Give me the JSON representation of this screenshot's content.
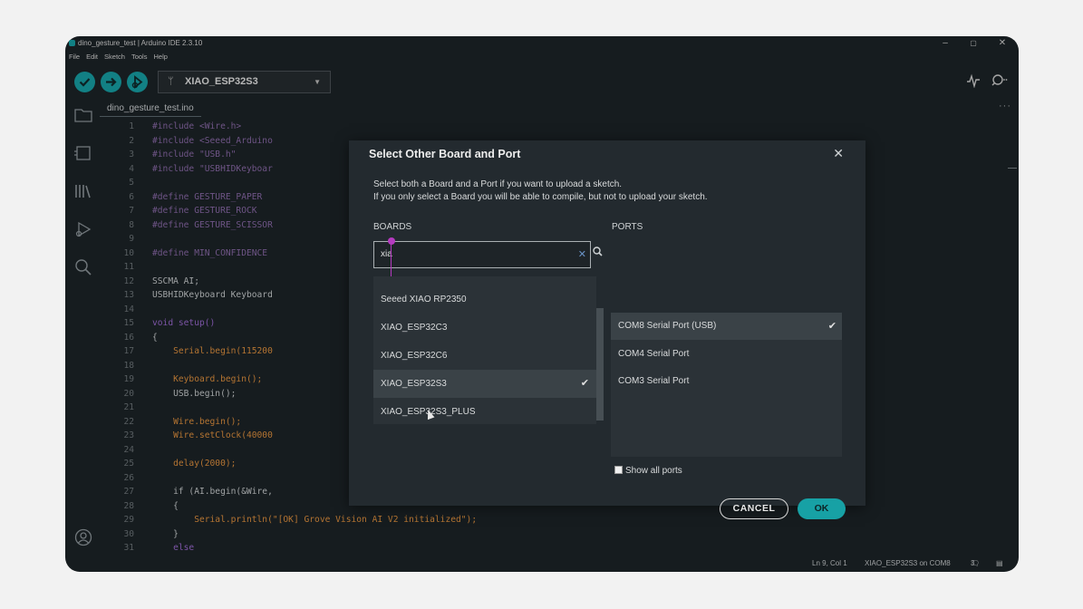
{
  "window": {
    "title": "dino_gesture_test | Arduino IDE 2.3.10",
    "controls": {
      "minimize": "–",
      "maximize": "▢",
      "close": "✕"
    }
  },
  "menu": [
    "File",
    "Edit",
    "Sketch",
    "Tools",
    "Help"
  ],
  "toolbar": {
    "verify_icon": "check-icon",
    "upload_icon": "arrow-right-icon",
    "debug_icon": "debug-icon",
    "board_name": "XIAO_ESP32S3",
    "serial_plotter_icon": "plotter-icon",
    "serial_monitor_icon": "monitor-icon"
  },
  "tab": {
    "filename": "dino_gesture_test.ino",
    "more": "···"
  },
  "editor": {
    "lines": [
      {
        "n": "1",
        "text": "#include <Wire.h>",
        "kind": "pre"
      },
      {
        "n": "2",
        "text": "#include <Seeed_Arduino",
        "kind": "pre"
      },
      {
        "n": "3",
        "text": "#include \"USB.h\"",
        "kind": "pre"
      },
      {
        "n": "4",
        "text": "#include \"USBHIDKeyboar",
        "kind": "pre"
      },
      {
        "n": "5",
        "text": "",
        "kind": "code"
      },
      {
        "n": "6",
        "text": "#define GESTURE_PAPER",
        "kind": "def"
      },
      {
        "n": "7",
        "text": "#define GESTURE_ROCK",
        "kind": "def"
      },
      {
        "n": "8",
        "text": "#define GESTURE_SCISSOR",
        "kind": "def"
      },
      {
        "n": "9",
        "text": "",
        "kind": "code"
      },
      {
        "n": "10",
        "text": "#define MIN_CONFIDENCE",
        "kind": "def"
      },
      {
        "n": "11",
        "text": "",
        "kind": "code"
      },
      {
        "n": "12",
        "text": "SSCMA AI;",
        "kind": "code"
      },
      {
        "n": "13",
        "text": "USBHIDKeyboard Keyboard",
        "kind": "code"
      },
      {
        "n": "14",
        "text": "",
        "kind": "code"
      },
      {
        "n": "15",
        "text": "void setup()",
        "kind": "kwfn"
      },
      {
        "n": "16",
        "text": "{",
        "kind": "code"
      },
      {
        "n": "17",
        "text": "    Serial.begin(115200",
        "kind": "fn"
      },
      {
        "n": "18",
        "text": "",
        "kind": "code"
      },
      {
        "n": "19",
        "text": "    Keyboard.begin();",
        "kind": "fn"
      },
      {
        "n": "20",
        "text": "    USB.begin();",
        "kind": "code"
      },
      {
        "n": "21",
        "text": "",
        "kind": "code"
      },
      {
        "n": "22",
        "text": "    Wire.begin();",
        "kind": "fn"
      },
      {
        "n": "23",
        "text": "    Wire.setClock(40000",
        "kind": "fn"
      },
      {
        "n": "24",
        "text": "",
        "kind": "code"
      },
      {
        "n": "25",
        "text": "    delay(2000);",
        "kind": "fn"
      },
      {
        "n": "26",
        "text": "",
        "kind": "code"
      },
      {
        "n": "27",
        "text": "    if (AI.begin(&Wire,",
        "kind": "code"
      },
      {
        "n": "28",
        "text": "    {",
        "kind": "code"
      },
      {
        "n": "29",
        "text": "        Serial.println(\"[OK] Grove Vision AI V2 initialized\");",
        "kind": "fn"
      },
      {
        "n": "30",
        "text": "    }",
        "kind": "code"
      },
      {
        "n": "31",
        "text": "    else",
        "kind": "kw"
      }
    ]
  },
  "dialog": {
    "title": "Select Other Board and Port",
    "close": "✕",
    "desc_line1": "Select both a Board and a Port if you want to upload a sketch.",
    "desc_line2": "If you only select a Board you will be able to compile, but not to upload your sketch.",
    "boards_label": "BOARDS",
    "ports_label": "PORTS",
    "search_value": "xia",
    "search_clear": "✕",
    "boards": [
      {
        "label": "Seeed XIAO RP2350",
        "selected": false
      },
      {
        "label": "XIAO_ESP32C3",
        "selected": false
      },
      {
        "label": "XIAO_ESP32C6",
        "selected": false
      },
      {
        "label": "XIAO_ESP32S3",
        "selected": true
      },
      {
        "label": "XIAO_ESP32S3_PLUS",
        "selected": false
      }
    ],
    "ports": [
      {
        "label": "COM8 Serial Port (USB)",
        "selected": true
      },
      {
        "label": "COM4 Serial Port",
        "selected": false
      },
      {
        "label": "COM3 Serial Port",
        "selected": false
      }
    ],
    "show_all_ports": "Show all ports",
    "cancel": "CANCEL",
    "ok": "OK",
    "check": "✔"
  },
  "status": {
    "position": "Ln 9, Col 1",
    "board_port": "XIAO_ESP32S3 on COM8",
    "notifications": "3"
  },
  "colors": {
    "accent": "#17a1a5",
    "background": "#1c2327",
    "dialog": "#232a2f"
  }
}
